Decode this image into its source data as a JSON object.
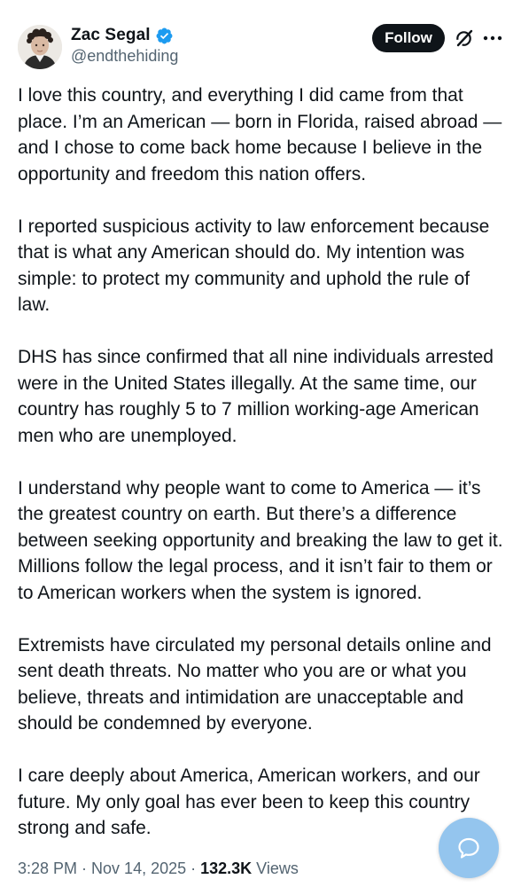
{
  "author": {
    "display_name": "Zac Segal",
    "handle": "@endthehiding",
    "verified": true,
    "verified_color": "#1d9bf0"
  },
  "actions": {
    "follow_label": "Follow",
    "grok_icon": "grok-icon",
    "more_icon": "more-horizontal-icon"
  },
  "tweet": {
    "paragraphs": [
      "I love this country, and everything I did came from that place. I’m an American — born in Florida, raised abroad — and I chose to come back home because I believe in the opportunity and freedom this nation offers.",
      "I reported suspicious activity to law enforcement because that is what any American should do. My intention was simple: to protect my community and uphold the rule of law.",
      "DHS has since confirmed that all nine individuals arrested were in the United States illegally. At the same time, our country has roughly 5 to 7 million working-age American men who are unemployed.",
      "I understand why people want to come to America — it’s the greatest country on earth. But there’s a difference between seeking opportunity and breaking the law to get it. Millions follow the legal process, and it isn’t fair to them or to American workers when the system is ignored.",
      "Extremists have circulated my personal details online and sent death threats. No matter who you are or what you believe, threats and intimidation are unacceptable and should be condemned by everyone.",
      "I care deeply about America, American workers, and our future. My only goal has ever been to keep this country strong and safe."
    ]
  },
  "meta": {
    "time": "3:28 PM",
    "separator": " · ",
    "date": "Nov 14, 2025",
    "views_count": "132.3K",
    "views_label": " Views"
  },
  "fab": {
    "icon": "chat-bubble-icon",
    "color": "#94c5ee"
  }
}
